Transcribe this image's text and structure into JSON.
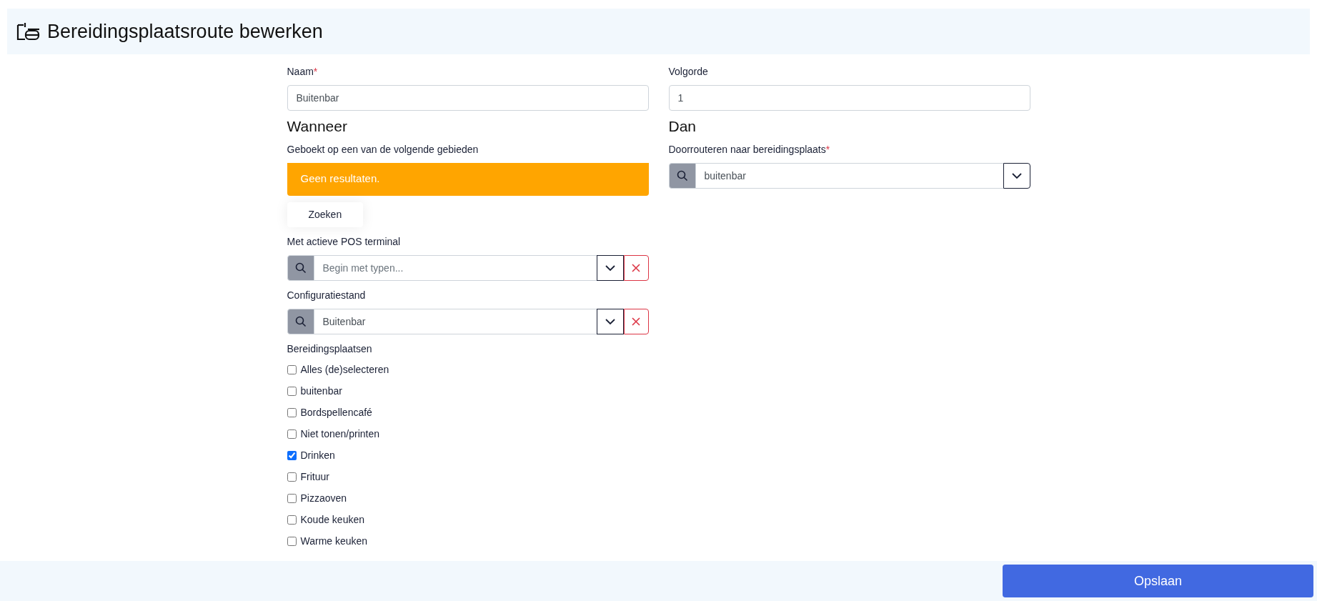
{
  "header": {
    "title": "Bereidingsplaatsroute bewerken"
  },
  "left": {
    "name_field": {
      "label": "Naam",
      "required_mark": "*",
      "value": "Buitenbar"
    },
    "when_heading": "Wanneer",
    "areas_label": "Geboekt op een van de volgende gebieden",
    "alert": "Geen resultaten.",
    "search_button": "Zoeken",
    "pos_field": {
      "label": "Met actieve POS terminal",
      "placeholder": "Begin met typen..."
    },
    "config_field": {
      "label": "Configuratiestand",
      "value": "Buitenbar"
    },
    "stations_label": "Bereidingsplaatsen",
    "stations": [
      {
        "label": "Alles (de)selecteren",
        "checked": false
      },
      {
        "label": "buitenbar",
        "checked": false
      },
      {
        "label": "Bordspellencafé",
        "checked": false
      },
      {
        "label": "Niet tonen/printen",
        "checked": false
      },
      {
        "label": "Drinken",
        "checked": true
      },
      {
        "label": "Frituur",
        "checked": false
      },
      {
        "label": "Pizzaoven",
        "checked": false
      },
      {
        "label": "Koude keuken",
        "checked": false
      },
      {
        "label": "Warme keuken",
        "checked": false
      }
    ]
  },
  "right": {
    "order_field": {
      "label": "Volgorde",
      "value": "1"
    },
    "then_heading": "Dan",
    "route_field": {
      "label": "Doorrouteren naar bereidingsplaats",
      "required_mark": "*",
      "value": "buitenbar"
    }
  },
  "footer": {
    "save_button": "Opslaan"
  }
}
